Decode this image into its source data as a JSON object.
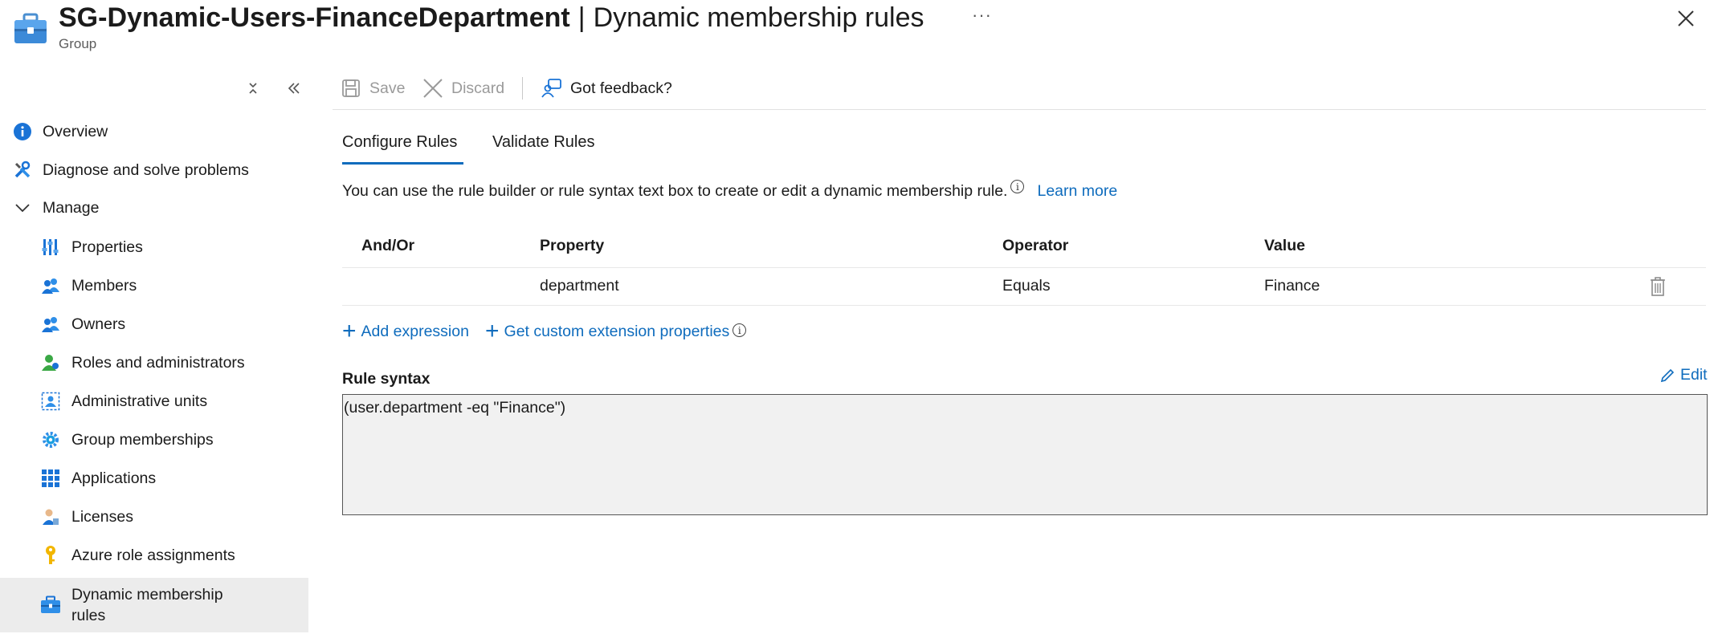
{
  "header": {
    "resource_name": "SG-Dynamic-Users-FinanceDepartment",
    "separator": "|",
    "page_name": "Dynamic membership rules",
    "subtitle": "Group",
    "more_label": "···"
  },
  "sidebar": {
    "items": [
      {
        "label": "Overview",
        "icon": "info-icon"
      },
      {
        "label": "Diagnose and solve problems",
        "icon": "wrench-icon"
      },
      {
        "label": "Manage",
        "icon": "chevron-down-icon"
      },
      {
        "label": "Properties",
        "icon": "properties-icon"
      },
      {
        "label": "Members",
        "icon": "members-icon"
      },
      {
        "label": "Owners",
        "icon": "owners-icon"
      },
      {
        "label": "Roles and administrators",
        "icon": "roles-icon"
      },
      {
        "label": "Administrative units",
        "icon": "admin-units-icon"
      },
      {
        "label": "Group memberships",
        "icon": "gear-icon"
      },
      {
        "label": "Applications",
        "icon": "grid-icon"
      },
      {
        "label": "Licenses",
        "icon": "license-icon"
      },
      {
        "label": "Azure role assignments",
        "icon": "key-icon"
      },
      {
        "label": "Dynamic membership rules",
        "icon": "briefcase-icon",
        "active": true
      }
    ]
  },
  "toolbar": {
    "save_label": "Save",
    "discard_label": "Discard",
    "feedback_label": "Got feedback?"
  },
  "tabs": [
    {
      "label": "Configure Rules",
      "selected": true
    },
    {
      "label": "Validate Rules",
      "selected": false
    }
  ],
  "description": {
    "text": "You can use the rule builder or rule syntax text box to create or edit a dynamic membership rule.",
    "info_glyph": "i",
    "learn_more": "Learn more"
  },
  "rules_table": {
    "columns": [
      "And/Or",
      "Property",
      "Operator",
      "Value"
    ],
    "rows": [
      {
        "and_or": "",
        "property": "department",
        "operator": "Equals",
        "value": "Finance"
      }
    ]
  },
  "actions": {
    "add_expression": "Add expression",
    "get_custom_extension": "Get custom extension properties",
    "plus_glyph": "+"
  },
  "rule_syntax": {
    "label": "Rule syntax",
    "edit_label": "Edit",
    "value": "(user.department -eq \"Finance\")"
  },
  "colors": {
    "accent": "#0f6cbd",
    "active_nav_bg": "#ececec",
    "disabled_text": "#9a9a9a"
  }
}
